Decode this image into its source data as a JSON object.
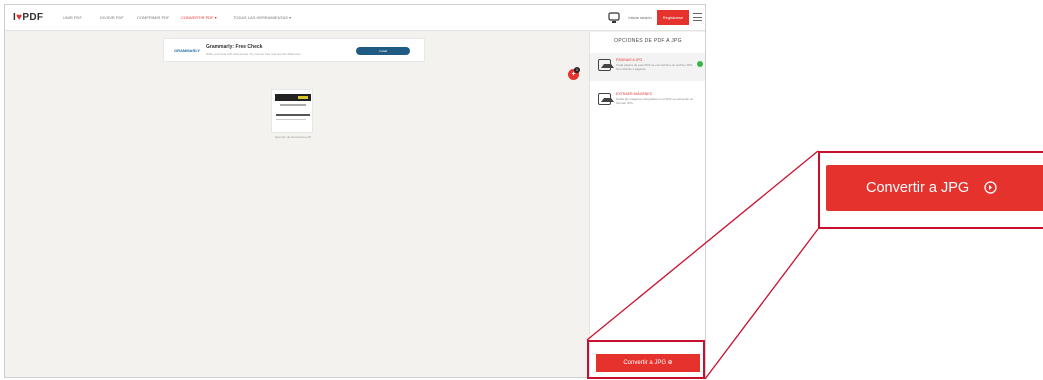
{
  "nav": {
    "logo_prefix": "I",
    "logo_heart": "♥",
    "logo_suffix": "PDF",
    "items": [
      {
        "label": "UNIR PDF"
      },
      {
        "label": "DIVIDIR PDF"
      },
      {
        "label": "COMPRIMIR PDF"
      },
      {
        "label": "CONVERTIR PDF ▾"
      },
      {
        "label": "TODAS LAS HERRAMIENTAS ▾"
      }
    ],
    "login_label": "Iniciar sesión",
    "signup_label": "Registrarse",
    "apps_icon": "grid-icon",
    "menu_icon": "hamburger-icon"
  },
  "ad": {
    "logo": "GRAMMARLY",
    "title": "Grammarly: Free Check",
    "subtitle": "Write your best with Grammarly. Try now for free and see the difference",
    "button_label": "Install"
  },
  "workspace": {
    "file_caption": "Ejemplo de documento.pdf",
    "add_button_icon": "plus-icon",
    "file_count": "1"
  },
  "sidebar": {
    "title": "OPCIONES DE PDF A JPG",
    "options": [
      {
        "title": "PÁGINAS A JPG",
        "desc": "Cada página de este PDF se convertirá a un archivo JPG. Se incluirán 1 páginas.",
        "selected": true
      },
      {
        "title": "EXTRAER IMÁGENES",
        "desc": "Todas las imágenes integradas en el PDF se extraerán en formato JPG.",
        "selected": false
      }
    ],
    "convert_button_label": "Convertir a JPG ⊕"
  },
  "callout": {
    "button_label": "Convertir a JPG",
    "icon": "circle-arrow-right-icon"
  },
  "colors": {
    "accent": "#e5322d",
    "highlight": "#c8102e",
    "workspace_bg": "#f4f2ef",
    "selected_check": "#3bb34a"
  }
}
